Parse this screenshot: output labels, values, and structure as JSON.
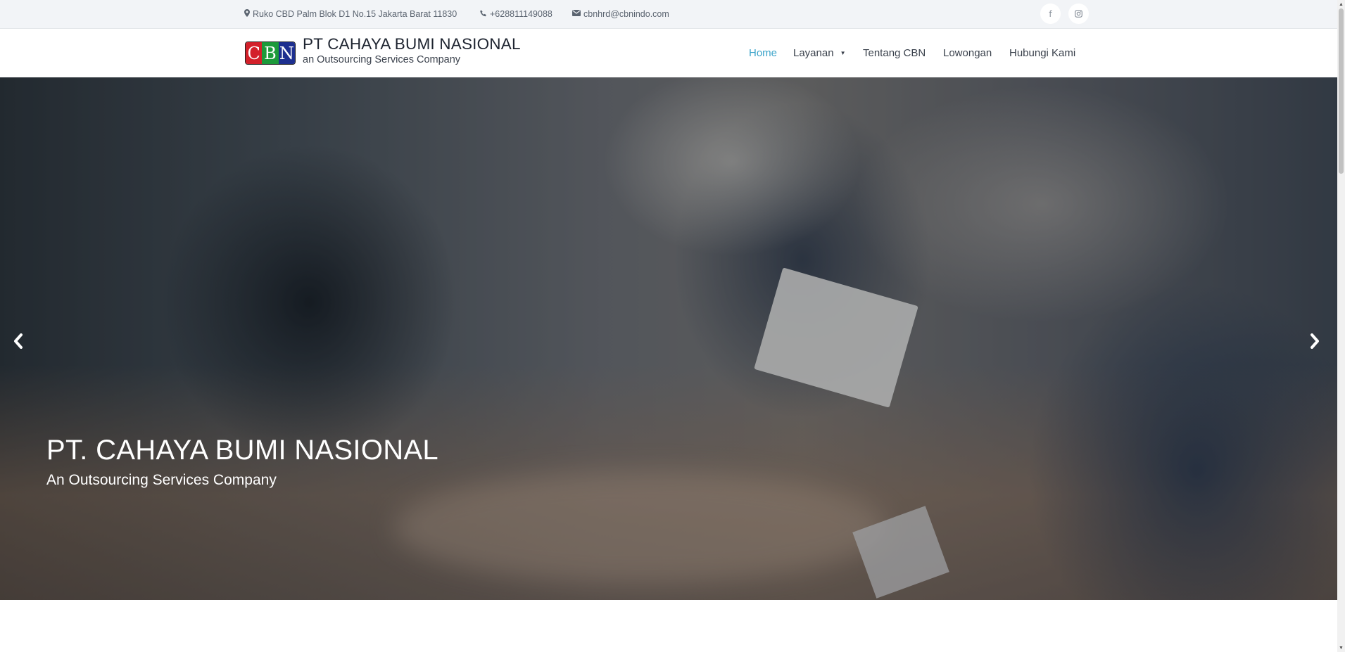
{
  "topbar": {
    "address_icon": "map-marker-icon",
    "address": "Ruko CBD Palm Blok D1 No.15 Jakarta Barat 11830",
    "phone_icon": "phone-icon",
    "phone": "+628811149088",
    "email_icon": "envelope-icon",
    "email": "cbnhrd@cbnindo.com",
    "social": [
      {
        "icon": "facebook-icon",
        "glyph": "f"
      },
      {
        "icon": "instagram-icon",
        "glyph": "◎"
      }
    ]
  },
  "header": {
    "logo_letters": [
      "C",
      "B",
      "N"
    ],
    "brand_title": "PT CAHAYA BUMI NASIONAL",
    "brand_subtitle": "an Outsourcing Services Company",
    "nav": [
      {
        "label": "Home",
        "active": true
      },
      {
        "label": "Layanan",
        "dropdown": true
      },
      {
        "label": "Tentang CBN"
      },
      {
        "label": "Lowongan"
      },
      {
        "label": "Hubungi Kami"
      }
    ],
    "active_color": "#3aa3c9"
  },
  "hero": {
    "title": "PT. CAHAYA BUMI NASIONAL",
    "subtitle": "An Outsourcing Services Company",
    "prev_icon": "chevron-left-icon",
    "next_icon": "chevron-right-icon"
  }
}
